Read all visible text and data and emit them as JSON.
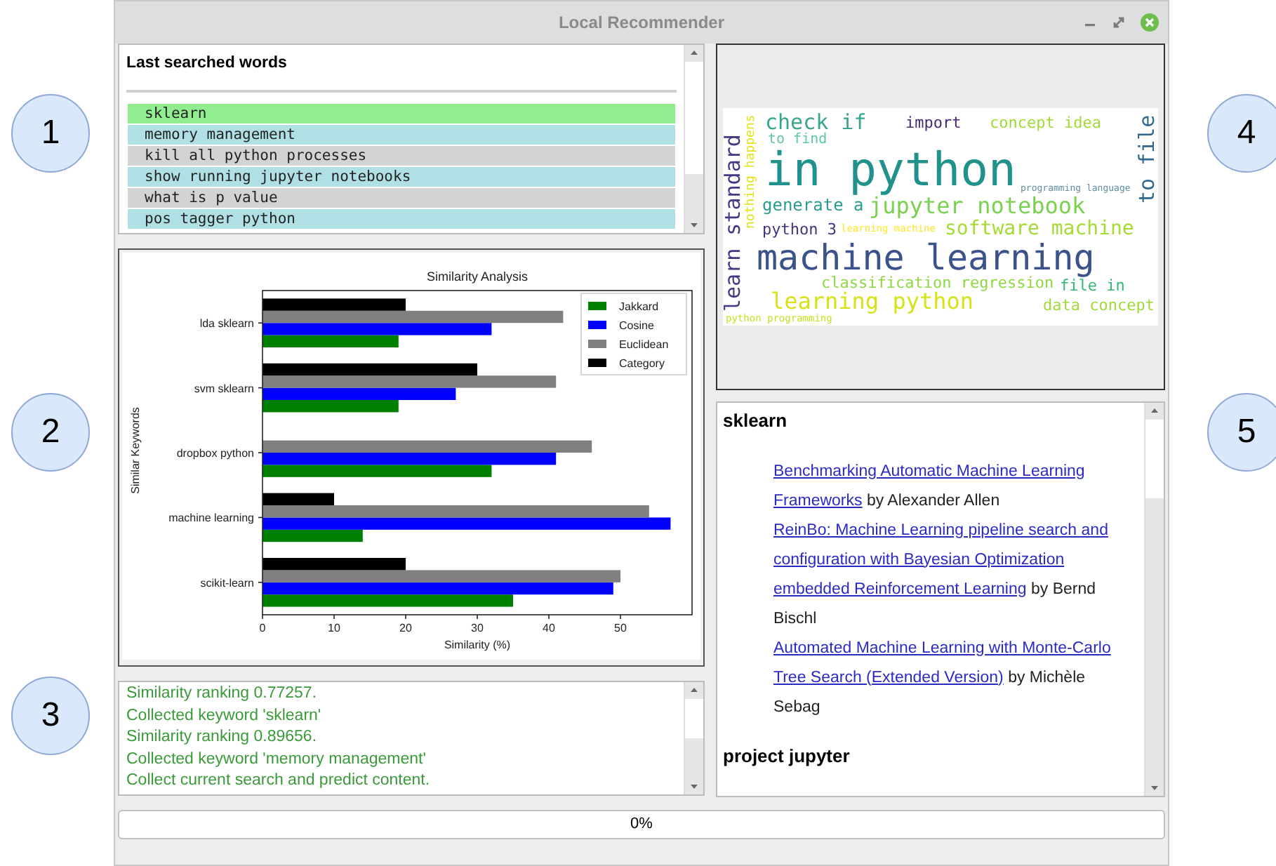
{
  "window": {
    "title": "Local Recommender"
  },
  "callouts": [
    {
      "label": "1"
    },
    {
      "label": "2"
    },
    {
      "label": "3"
    },
    {
      "label": "4"
    },
    {
      "label": "5"
    }
  ],
  "searched_words": {
    "title": "Last searched words",
    "items": [
      {
        "text": "sklearn",
        "selected": true
      },
      {
        "text": "memory management",
        "selected": false
      },
      {
        "text": "kill all python processes",
        "selected": false
      },
      {
        "text": "show running jupyter notebooks",
        "selected": false
      },
      {
        "text": "what is p value",
        "selected": false
      },
      {
        "text": "pos tagger python",
        "selected": false
      }
    ]
  },
  "similarity_chart": {
    "chart_data": {
      "type": "bar",
      "orientation": "horizontal",
      "title": "Similarity Analysis",
      "xlabel": "Similarity (%)",
      "ylabel": "Similar Keywords",
      "categories": [
        "lda sklearn",
        "svm sklearn",
        "dropbox python",
        "machine learning",
        "scikit-learn"
      ],
      "series": [
        {
          "name": "Jakkard",
          "color": "#008000",
          "values": [
            19,
            19,
            32,
            14,
            35
          ]
        },
        {
          "name": "Cosine",
          "color": "#0000ff",
          "values": [
            32,
            27,
            41,
            57,
            49
          ]
        },
        {
          "name": "Euclidean",
          "color": "#808080",
          "values": [
            42,
            41,
            46,
            54,
            50
          ]
        },
        {
          "name": "Category",
          "color": "#000000",
          "values": [
            20,
            30,
            0,
            10,
            20
          ]
        }
      ],
      "xlim": [
        0,
        60
      ],
      "xticks": [
        0,
        10,
        20,
        30,
        40,
        50
      ],
      "legend": true
    }
  },
  "log": {
    "lines": [
      "Similarity ranking 0.77257.",
      "Collected keyword 'sklearn'",
      "Similarity ranking 0.89656.",
      "Collected keyword 'memory management'",
      "Collect current search and predict content."
    ]
  },
  "word_cloud": {
    "words": [
      {
        "text": "check if",
        "color": "#3aa58f"
      },
      {
        "text": "import",
        "color": "#482878"
      },
      {
        "text": "concept idea",
        "color": "#a0da39"
      },
      {
        "text": "to file",
        "color": "#31688e"
      },
      {
        "text": "to find",
        "color": "#5ec9a0"
      },
      {
        "text": "in python",
        "color": "#21918c"
      },
      {
        "text": "learn standard",
        "color": "#443983"
      },
      {
        "text": "nothing happens",
        "color": "#e2e418"
      },
      {
        "text": "generate a",
        "color": "#2a9d8f"
      },
      {
        "text": "programming language",
        "color": "#5f8fa0"
      },
      {
        "text": "jupyter notebook",
        "color": "#7ad151"
      },
      {
        "text": "python 3",
        "color": "#46327e"
      },
      {
        "text": "learning machine",
        "color": "#fde725"
      },
      {
        "text": "software machine",
        "color": "#a5db36"
      },
      {
        "text": "machine learning",
        "color": "#3b528b"
      },
      {
        "text": "classification regression",
        "color": "#90d743"
      },
      {
        "text": "file in",
        "color": "#35b779"
      },
      {
        "text": "learning python",
        "color": "#d8e219"
      },
      {
        "text": "data concept",
        "color": "#9fda3a"
      },
      {
        "text": "python programming",
        "color": "#c8e020"
      }
    ]
  },
  "references": {
    "sections": [
      {
        "heading": "sklearn",
        "items": [
          {
            "title_lines": [
              "Benchmarking Automatic Machine Learning",
              "Frameworks"
            ],
            "byline_lines": [
              "by Alexander Allen"
            ]
          },
          {
            "title_lines": [
              "ReinBo: Machine Learning pipeline search and",
              "configuration with Bayesian Optimization",
              "embedded Reinforcement Learning"
            ],
            "byline_lines": [
              "by Bernd",
              "Bischl"
            ]
          },
          {
            "title_lines": [
              "Automated Machine Learning with Monte-Carlo",
              "Tree Search (Extended Version)"
            ],
            "byline_lines": [
              "by Michèle",
              "Sebag"
            ]
          }
        ]
      },
      {
        "heading": "project jupyter"
      }
    ]
  },
  "progress": {
    "level": 0,
    "text": "0%"
  }
}
